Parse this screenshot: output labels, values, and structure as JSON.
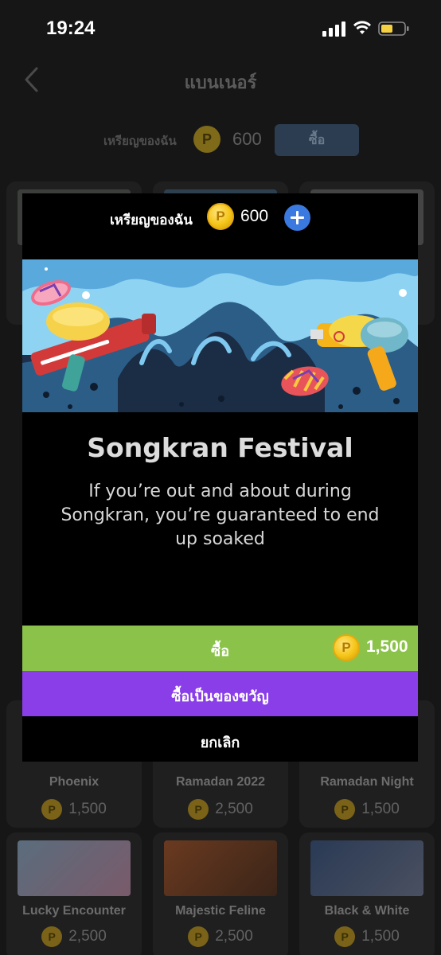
{
  "status": {
    "time": "19:24"
  },
  "nav": {
    "title": "แบนเนอร์"
  },
  "header": {
    "coins_label": "เหรียญของฉัน",
    "coins_value": "600",
    "buy_label": "ซื้อ",
    "coin_glyph": "P"
  },
  "grid": [
    {
      "name": "Phoenix",
      "price": "1,500"
    },
    {
      "name": "Ramadan 2022",
      "price": "2,500"
    },
    {
      "name": "Ramadan Night",
      "price": "1,500"
    },
    {
      "name": "Lucky Encounter",
      "price": "2,500"
    },
    {
      "name": "Majestic Feline",
      "price": "2,500"
    },
    {
      "name": "Black & White",
      "price": "1,500"
    }
  ],
  "modal": {
    "coins_label": "เหรียญของฉัน",
    "coins_value": "600",
    "title": "Songkran Festival",
    "description": "If you’re out and about during Songkran, you’re guaranteed to end up soaked",
    "buy_label": "ซื้อ",
    "price": "1,500",
    "gift_label": "ซื้อเป็นของขวัญ",
    "cancel_label": "ยกเลิก"
  },
  "colors": {
    "accent_buy": "#8bc34a",
    "accent_gift": "#8a3ee8",
    "plus": "#3a7ae0",
    "coin": "#f5c518"
  }
}
